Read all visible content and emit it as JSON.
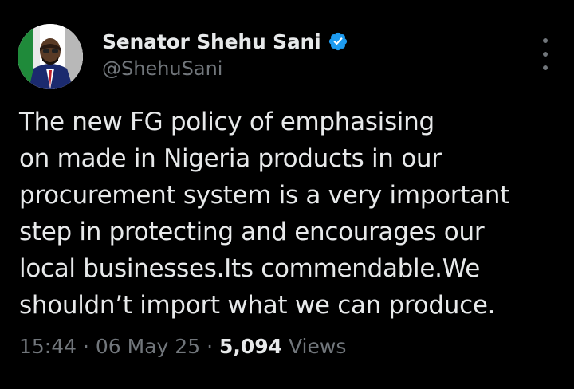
{
  "author": {
    "display_name": "Senator Shehu Sani",
    "handle": "@ShehuSani",
    "verified": true,
    "verified_color": "#1d9bf0"
  },
  "tweet": {
    "lines": [
      "The new FG policy of emphasising",
      "on made in Nigeria products in our",
      "procurement system is a very important",
      "step in protecting and encourages our",
      "local businesses.Its commendable.We",
      "shouldn’t import what we can produce."
    ]
  },
  "meta": {
    "time": "15:44",
    "separator": "·",
    "date": "06 May 25",
    "views_count": "5,094",
    "views_label": "Views"
  },
  "icons": {
    "more": "more-vertical-icon",
    "verified": "verified-badge-icon"
  },
  "colors": {
    "background": "#000000",
    "primary_text": "#e7e9ea",
    "secondary_text": "#71767b"
  }
}
